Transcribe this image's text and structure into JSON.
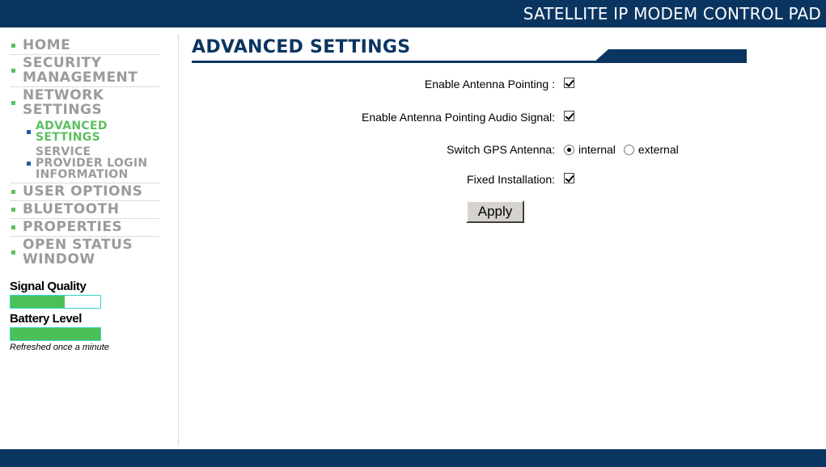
{
  "header": {
    "title": "SATELLITE IP MODEM CONTROL PAD"
  },
  "sidebar": {
    "items": [
      {
        "label": "HOME"
      },
      {
        "label": "SECURITY MANAGEMENT"
      },
      {
        "label": "NETWORK SETTINGS"
      },
      {
        "label": "ADVANCED SETTINGS"
      },
      {
        "label": "SERVICE PROVIDER LOGIN INFORMATION"
      },
      {
        "label": "USER OPTIONS"
      },
      {
        "label": "BLUETOOTH"
      },
      {
        "label": "PROPERTIES"
      },
      {
        "label": "OPEN STATUS WINDOW"
      }
    ],
    "signal": {
      "label": "Signal Quality",
      "level": 0.6
    },
    "battery": {
      "label": "Battery Level",
      "level": 1.0
    },
    "refresh_note": "Refreshed once a minute"
  },
  "main": {
    "title": "ADVANCED SETTINGS",
    "fields": {
      "antenna_pointing": {
        "label": "Enable Antenna Pointing :",
        "checked": true
      },
      "audio_signal": {
        "label": "Enable Antenna Pointing Audio Signal:",
        "checked": true
      },
      "gps_antenna": {
        "label": "Switch GPS Antenna:",
        "options": [
          "internal",
          "external"
        ],
        "selected": "internal"
      },
      "fixed_install": {
        "label": "Fixed Installation:",
        "checked": true
      }
    },
    "apply_label": "Apply"
  },
  "colors": {
    "navy": "#0b3561",
    "green": "#5cc060",
    "meter_border": "#39d3d3"
  }
}
